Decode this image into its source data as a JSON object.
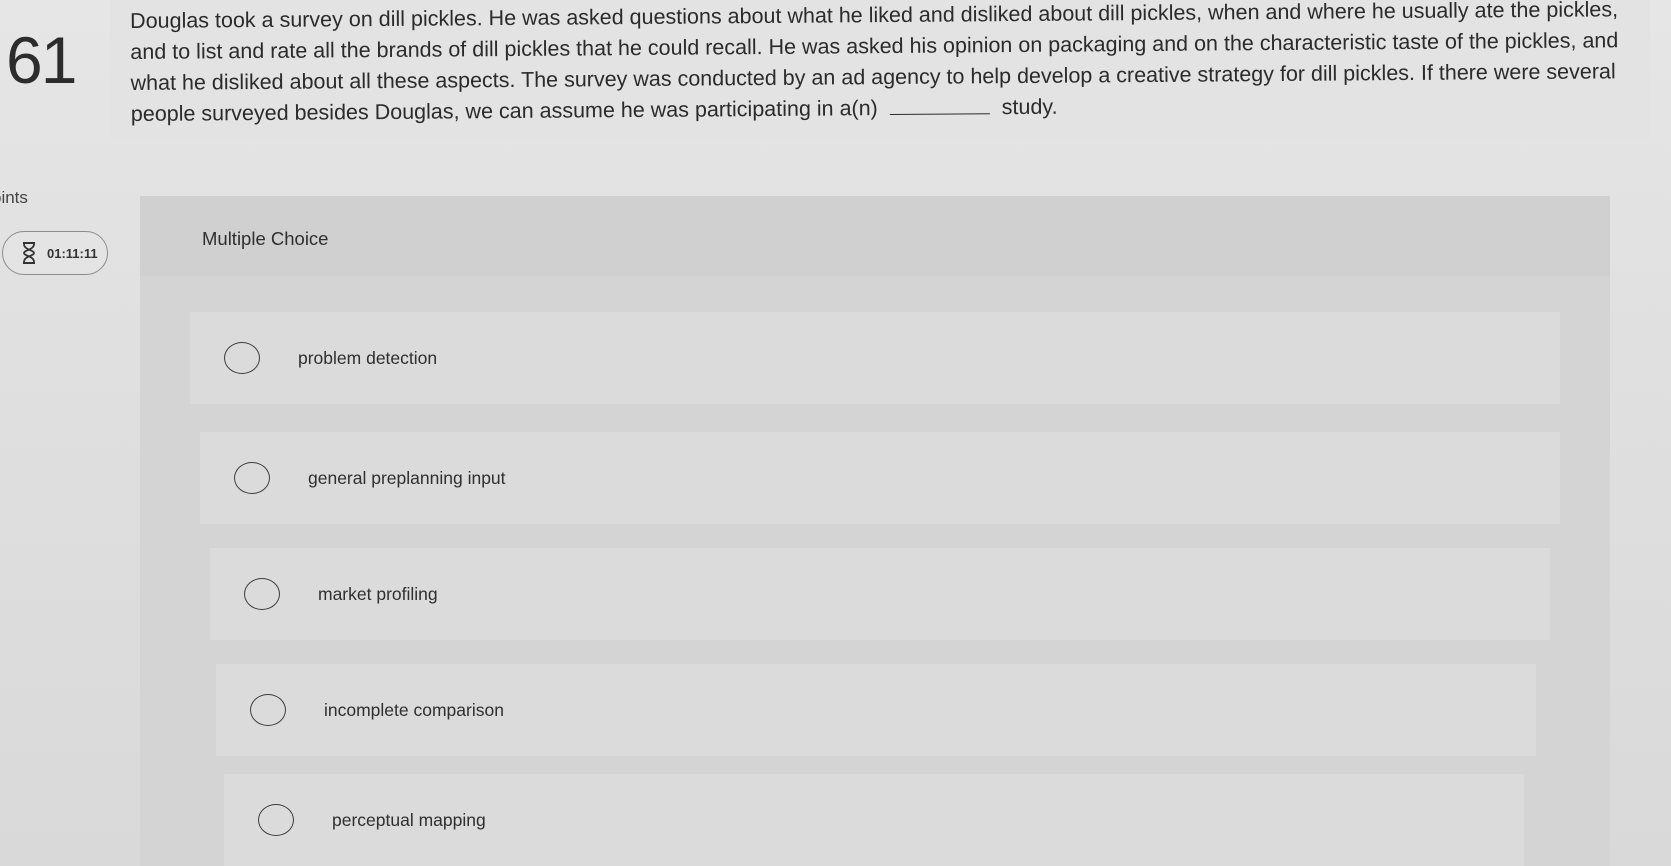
{
  "question": {
    "number": "61",
    "text_before_blank": "Douglas took a survey on dill pickles. He was asked questions about what he liked and disliked about dill pickles, when and where he usually ate the pickles, and to list and rate all the brands of dill pickles that he could recall. He was asked his opinion on packaging and on the characteristic taste of the pickles, and what he disliked about all these aspects. The survey was conducted by an ad agency to help develop a creative strategy for dill pickles. If there were several people surveyed besides Douglas, we can assume he was participating in a(n)",
    "text_after_blank": "study."
  },
  "sidebar": {
    "points_label": "oints",
    "timer": {
      "icon": "hourglass-icon",
      "value": "01:11:11"
    }
  },
  "answer_area": {
    "type_label": "Multiple Choice",
    "options": [
      {
        "label": "problem detection",
        "selected": false
      },
      {
        "label": "general preplanning input",
        "selected": false
      },
      {
        "label": "market profiling",
        "selected": false
      },
      {
        "label": "incomplete comparison",
        "selected": false
      },
      {
        "label": "perceptual mapping",
        "selected": false
      }
    ]
  }
}
